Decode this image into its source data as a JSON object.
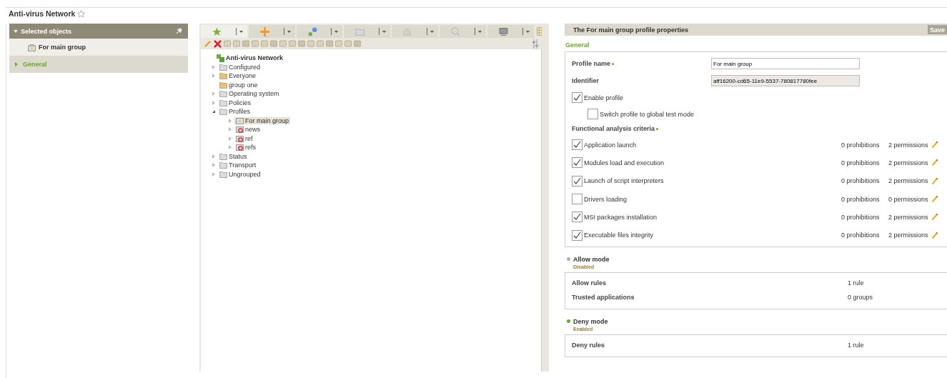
{
  "header": {
    "title": "Anti-virus Network"
  },
  "sidebar": {
    "title": "Selected objects",
    "selected_object": "For main group",
    "sections": [
      {
        "label": "General",
        "selected": true
      }
    ]
  },
  "tree": [
    {
      "label": "Anti-virus Network",
      "kind": "root",
      "selected": false,
      "children": [
        {
          "label": "Configured",
          "kind": "folder",
          "expanded": false,
          "selected": false
        },
        {
          "label": "Everyone",
          "kind": "user-folder",
          "expanded": false,
          "selected": false
        },
        {
          "label": "group one",
          "kind": "user-folder",
          "selected": false
        },
        {
          "label": "Operating system",
          "kind": "folder",
          "expanded": false,
          "selected": false
        },
        {
          "label": "Policies",
          "kind": "folder",
          "expanded": false,
          "selected": false
        },
        {
          "label": "Profiles",
          "kind": "folder",
          "expanded": true,
          "selected": false,
          "children": [
            {
              "label": "For main group",
              "kind": "profile",
              "expanded": false,
              "selected": true
            },
            {
              "label": "news",
              "kind": "alert-profile",
              "expanded": false,
              "selected": false
            },
            {
              "label": "ref",
              "kind": "alert-profile",
              "expanded": false,
              "selected": false
            },
            {
              "label": "refs",
              "kind": "alert-profile",
              "expanded": false,
              "selected": false
            }
          ]
        },
        {
          "label": "Status",
          "kind": "folder",
          "expanded": false,
          "selected": false
        },
        {
          "label": "Transport",
          "kind": "folder",
          "expanded": false,
          "selected": false
        },
        {
          "label": "Ungrouped",
          "kind": "folder",
          "expanded": false,
          "selected": false
        }
      ]
    }
  ],
  "properties": {
    "title": "The For main group profile properties",
    "save_button": "Save",
    "section": "General",
    "profile_name": {
      "label": "Profile name",
      "value": "For main group"
    },
    "identifier": {
      "label": "Identifier",
      "value": "aff16200-cd65-11e9-5537-780817780fee"
    },
    "enable_profile": {
      "label": "Enable profile",
      "checked": true
    },
    "test_mode": {
      "label": "Switch profile to global test mode",
      "checked": false
    },
    "criteria_title": "Functional analysis criteria",
    "criteria": [
      {
        "label": "Application launch",
        "checked": true,
        "prohibitions": "0 prohibitions",
        "permissions": "2 permissions"
      },
      {
        "label": "Modules load and execution",
        "checked": true,
        "prohibitions": "0 prohibitions",
        "permissions": "2 permissions"
      },
      {
        "label": "Launch of script interpreters",
        "checked": true,
        "prohibitions": "0 prohibitions",
        "permissions": "2 permissions"
      },
      {
        "label": "Drivers loading",
        "checked": false,
        "prohibitions": "0 prohibitions",
        "permissions": "0 permissions"
      },
      {
        "label": "MSI packages installation",
        "checked": true,
        "prohibitions": "0 prohibitions",
        "permissions": "2 permissions"
      },
      {
        "label": "Executable files integrity",
        "checked": true,
        "prohibitions": "0 prohibitions",
        "permissions": "2 permissions"
      }
    ],
    "modes": [
      {
        "title": "Allow mode",
        "status": "Disabled",
        "color": "#b0b0b0",
        "rows": [
          {
            "label": "Allow rules",
            "value": "1 rule"
          },
          {
            "label": "Trusted applications",
            "value": "0 groups"
          }
        ]
      },
      {
        "title": "Deny mode",
        "status": "Enabled",
        "color": "#6aa82a",
        "rows": [
          {
            "label": "Deny rules",
            "value": "1 rule"
          }
        ]
      }
    ]
  }
}
